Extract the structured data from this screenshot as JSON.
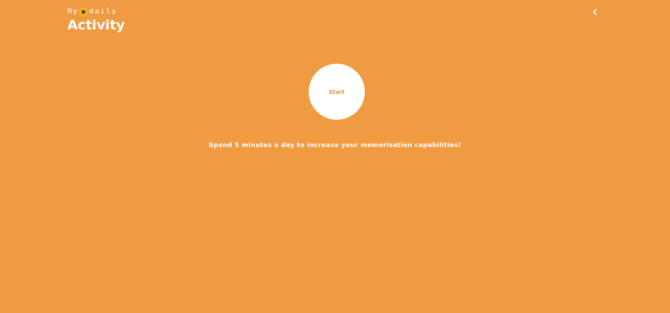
{
  "logo": {
    "prefix": "My",
    "icon": "sunflower-icon",
    "suffix": "daily",
    "title": "Activity"
  },
  "header": {
    "back_icon": "chevron-left-icon"
  },
  "main": {
    "start_label": "Start",
    "tagline": "Spend 5 minutes a day to increase your memorisation capabilities!"
  },
  "colors": {
    "background": "#F09B42",
    "text": "#FFFFFF",
    "button_background": "#FFFFFF",
    "button_text": "#E2953D",
    "sun_petals": "#F5C400",
    "sun_center": "#5A3A10"
  }
}
